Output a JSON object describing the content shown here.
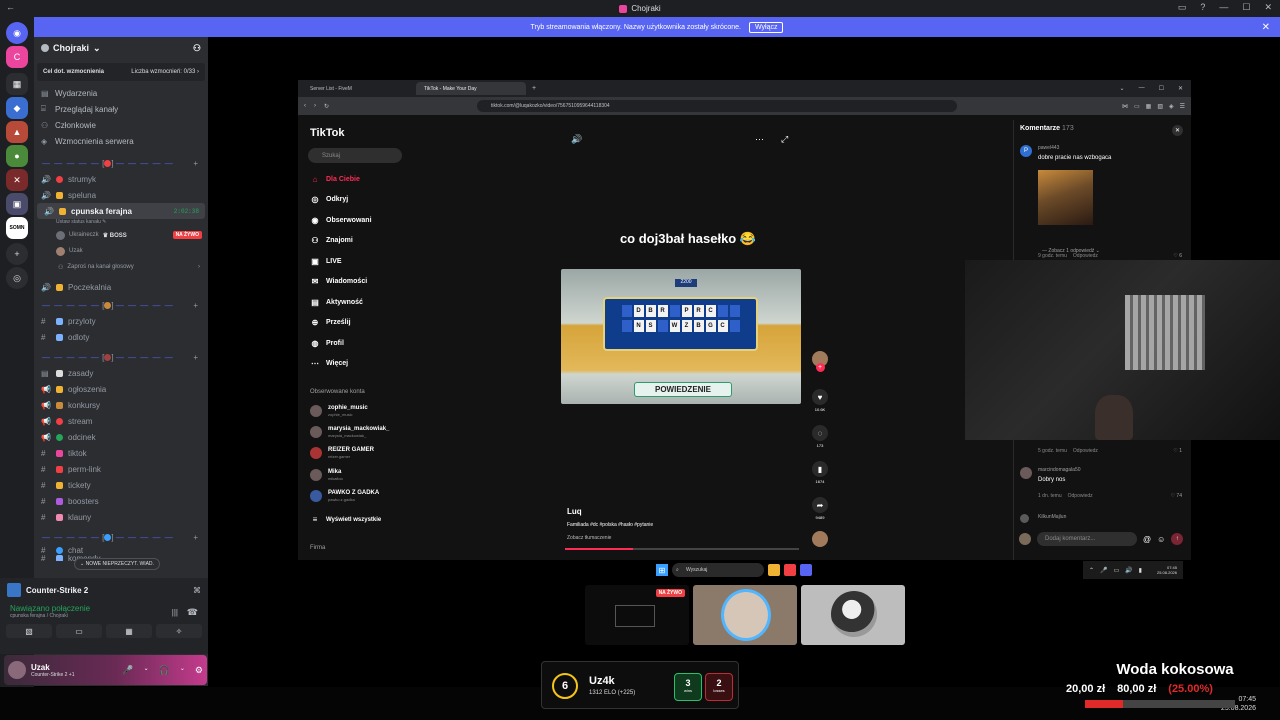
{
  "window": {
    "title": "Chojraki",
    "back_glyph": "←",
    "ctrls": [
      "▭",
      "?",
      "—",
      "☐",
      "✕"
    ]
  },
  "banner": {
    "text": "Tryb streamowania włączony. Nazwy użytkownika zostały skrócone.",
    "button": "Wyłącz",
    "close": "✕"
  },
  "rail": {
    "servers": [
      {
        "label": "◉",
        "color": "#5865f2"
      },
      {
        "label": "C",
        "color": "#eb459e"
      },
      {
        "label": "▦",
        "color": "#2b2d31"
      },
      {
        "label": "◆",
        "color": "#3a6fd1"
      },
      {
        "label": "▲",
        "color": "#b84a3a"
      },
      {
        "label": "●",
        "color": "#4a8a3a"
      },
      {
        "label": "✕",
        "color": "#7a2a2a"
      },
      {
        "label": "▣",
        "color": "#4a4a6a"
      },
      {
        "label": "SOMN",
        "color": "#ffffff"
      },
      {
        "label": "+",
        "color": "#2b2d31"
      },
      {
        "label": "◎",
        "color": "#2b2d31"
      }
    ]
  },
  "server": {
    "name": "Chojraki",
    "chevron": "⌄",
    "add_user": "⚇",
    "boost_goal": "Cel dot. wzmocnienia",
    "boost_count": "Liczba wzmocnień: 0/33",
    "boost_arrow": "›",
    "menu": [
      {
        "icon": "▤",
        "label": "Wydarzenia"
      },
      {
        "icon": "⌸",
        "label": "Przeglądaj kanały"
      },
      {
        "icon": "⚇",
        "label": "Członkowie"
      },
      {
        "icon": "◈",
        "label": "Wzmocnienia serwera"
      }
    ],
    "categories": [
      {
        "dash": "— — — — —",
        "emoji_color": "#f23f43",
        "bracket_l": "[",
        "bracket_r": "]",
        "plus": "+"
      },
      {
        "dash": "— — — — —",
        "emoji_color": "#c98a3c",
        "bracket_l": "[",
        "bracket_r": "]",
        "plus": "+"
      },
      {
        "dash": "— — — — —",
        "emoji_color": "#a04040",
        "bracket_l": "[",
        "bracket_r": "]",
        "plus": "+"
      },
      {
        "dash": "— — — — —",
        "emoji_color": "#3aa0ff",
        "bracket_l": "[",
        "bracket_r": "]",
        "plus": "+"
      }
    ],
    "voice_channels": [
      {
        "icon": "🔊",
        "name": "strumyk",
        "color": "#f23f43"
      },
      {
        "icon": "🔊",
        "name": "speluna",
        "color": "#f0b232"
      },
      {
        "icon": "🔊",
        "name": "cpunska ferajna",
        "color": "#f0b232",
        "time": "2:02:38",
        "status": "Ustaw status kanału ✎"
      }
    ],
    "voice_users": [
      {
        "name": "Ukraineczk",
        "tag": "♛ BOSS",
        "live": "NA ŻYWO"
      },
      {
        "name": "Uzak"
      }
    ],
    "invite": "Zaproś na kanał głosowy",
    "invite_icon": "⚇",
    "invite_arrow": "›",
    "waiting": {
      "icon": "🔊",
      "name": "Poczekalnia",
      "color": "#f0b232"
    },
    "text_group1": [
      {
        "icon": "#",
        "name": "przyloty",
        "color": "#7bb3ff"
      },
      {
        "icon": "#",
        "name": "odloty",
        "color": "#7bb3ff"
      }
    ],
    "text_group2": [
      {
        "icon": "▤",
        "name": "zasady",
        "color": "#dddddd"
      },
      {
        "icon": "📢",
        "name": "ogłoszenia",
        "color": "#f0b232"
      },
      {
        "icon": "📢",
        "name": "konkursy",
        "color": "#c98a3c"
      },
      {
        "icon": "📢",
        "name": "stream",
        "color": "#f23f43"
      },
      {
        "icon": "📢",
        "name": "odcinek",
        "color": "#23a55a"
      },
      {
        "icon": "#",
        "name": "tiktok",
        "color": "#eb459e"
      },
      {
        "icon": "#",
        "name": "perm-link",
        "color": "#f23f43"
      },
      {
        "icon": "#",
        "name": "tickety",
        "color": "#f0b232"
      },
      {
        "icon": "#",
        "name": "boosters",
        "color": "#b05ae0"
      },
      {
        "icon": "#",
        "name": "klauny",
        "color": "#f08ab0"
      }
    ],
    "text_group3": [
      {
        "icon": "#",
        "name": "chat",
        "color": "#3aa0ff"
      },
      {
        "icon": "#",
        "name": "komendy",
        "color": "#7bb3ff"
      }
    ],
    "new_unread": "⌄ NOWE NIEPRZECZYT. WIAD."
  },
  "activity": {
    "game": "Counter-Strike 2",
    "game_action": "⌘",
    "rtc_status": "Nawiązano połączenie",
    "rtc_channel": "cpunska ferajna / Chojraki",
    "rtc_icons": [
      "|||",
      "☎"
    ],
    "buttons": [
      "▧",
      "▭",
      "▦",
      "✧"
    ]
  },
  "user": {
    "name": "Uzak",
    "status": "Counter-Strike 2 +1",
    "ctrls": [
      "🎤",
      "⌄",
      "🎧",
      "⌄",
      "⚙"
    ]
  },
  "browser": {
    "tabs": [
      "Server List - FiveM",
      "TikTok - Make Your Day",
      "+"
    ],
    "url": "tiktok.com/@luqakozko/video/7567510959644118304",
    "nav": [
      "‹",
      "›",
      "↻"
    ],
    "ext": [
      "⋈",
      "▭",
      "▦",
      "▧",
      "◈",
      "☰"
    ],
    "win_ctrls": [
      "⌄",
      "—",
      "☐",
      "✕"
    ]
  },
  "tiktok": {
    "logo": "TikTok",
    "search_placeholder": "Szukaj",
    "nav": [
      {
        "icon": "⌂",
        "label": "Dla Ciebie"
      },
      {
        "icon": "◎",
        "label": "Odkryj"
      },
      {
        "icon": "◉",
        "label": "Obserwowani"
      },
      {
        "icon": "⚇",
        "label": "Znajomi"
      },
      {
        "icon": "▣",
        "label": "LIVE"
      },
      {
        "icon": "✉",
        "label": "Wiadomości"
      },
      {
        "icon": "▤",
        "label": "Aktywność"
      },
      {
        "icon": "⊕",
        "label": "Prześlij"
      },
      {
        "icon": "◍",
        "label": "Profil"
      },
      {
        "icon": "⋯",
        "label": "Więcej"
      }
    ],
    "followed_title": "Obserwowane konta",
    "followed": [
      {
        "name": "zophie_music",
        "user": "zophie_music"
      },
      {
        "name": "marysia_mackowiak_",
        "user": "marysia_mackowiak_"
      },
      {
        "name": "REIZER GAMER",
        "user": "reizer.gamer"
      },
      {
        "name": "Mika",
        "user": "mikaltoo"
      },
      {
        "name": "PAWKO Z GADKA",
        "user": "pawko.z.gadka"
      }
    ],
    "see_all": "Wyświetl wszystkie",
    "see_all_icon": "≡",
    "firma": "Firma",
    "top_icons": [
      "🔊",
      "⋯",
      "⤢"
    ],
    "caption": "co doj3bał hasełko 😂",
    "author": "Luq",
    "desc": "Familiada #dc #polska #hasło #pytanie",
    "translate": "Zobacz tłumaczenie",
    "progress": 0.29,
    "video": {
      "score": "2200",
      "row1": [
        "",
        "D",
        "B",
        "R",
        "",
        "P",
        "R",
        "C",
        "",
        ""
      ],
      "row2": [
        "",
        "N",
        "S",
        "",
        "W",
        "Z",
        "B",
        "G",
        "C",
        ""
      ],
      "banner": "POWIEDZENIE"
    },
    "actions": [
      {
        "icon": "+",
        "count": ""
      },
      {
        "icon": "♥",
        "count": "10.6K"
      },
      {
        "icon": "◌",
        "count": "173"
      },
      {
        "icon": "▮",
        "count": "1674"
      },
      {
        "icon": "➦",
        "count": "9489"
      }
    ]
  },
  "comments": {
    "title": "Komentarze",
    "count": "173",
    "close": "✕",
    "items": [
      {
        "avatar": "P",
        "user": "pawel443",
        "text": "dobre pracie nas wzbogaca",
        "time": "9 godz. temu",
        "reply": "Odpowiedz",
        "likes": "♡ 6"
      },
      {
        "avatar": "",
        "user": "",
        "text": "",
        "time": "5 godz. temu",
        "reply": "Odpowiedz",
        "likes": "♡ 1"
      },
      {
        "avatar": "",
        "user": "marcindomagala50",
        "text": "Dobry nos",
        "time": "1 dn. temu",
        "reply": "Odpowiedz",
        "likes": "♡ 74"
      },
      {
        "avatar": "",
        "user": "KilkunMajlun",
        "text": "",
        "time": "",
        "reply": "",
        "likes": ""
      }
    ],
    "more_replies": "— Zobacz 1 odpowiedź ⌄",
    "input_placeholder": "Dodaj komentarz...",
    "input_icons": [
      "@",
      "☺"
    ],
    "send": "↑"
  },
  "taskbar": {
    "win": "⊞",
    "search": "Wyszukaj",
    "search_icon": "⌕",
    "apps": [
      "#f0b232",
      "#f23f43",
      "#5865f2"
    ],
    "tray_icons": [
      "⌃",
      "🎤",
      "▭",
      "🔊",
      "▮"
    ],
    "clock": "07:45",
    "date": "25.08.2026"
  },
  "tiles": {
    "live": "NA ŻYWO"
  },
  "elo": {
    "level": "6",
    "name": "Uz4k",
    "points": "1312 ELO (+225)",
    "wins": "3",
    "wins_label": "wins",
    "losses": "2",
    "losses_label": "losses"
  },
  "goal": {
    "title": "Woda kokosowa",
    "current": "20,00 zł",
    "target": "80,00 zł",
    "percent": "(25.00%)",
    "progress": 0.25
  },
  "bottom": {
    "time": "07:45",
    "date": "25.08.2026"
  }
}
